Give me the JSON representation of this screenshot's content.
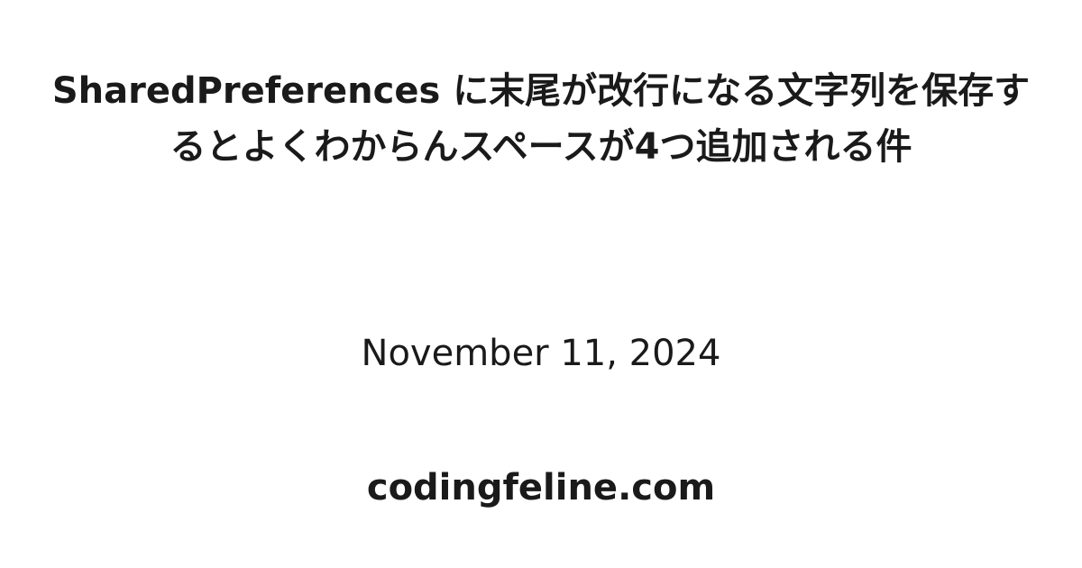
{
  "title": "SharedPreferences に末尾が改行になる文字列を保存するとよくわからんスペースが4つ追加される件",
  "date": "November 11, 2024",
  "site": "codingfeline.com"
}
